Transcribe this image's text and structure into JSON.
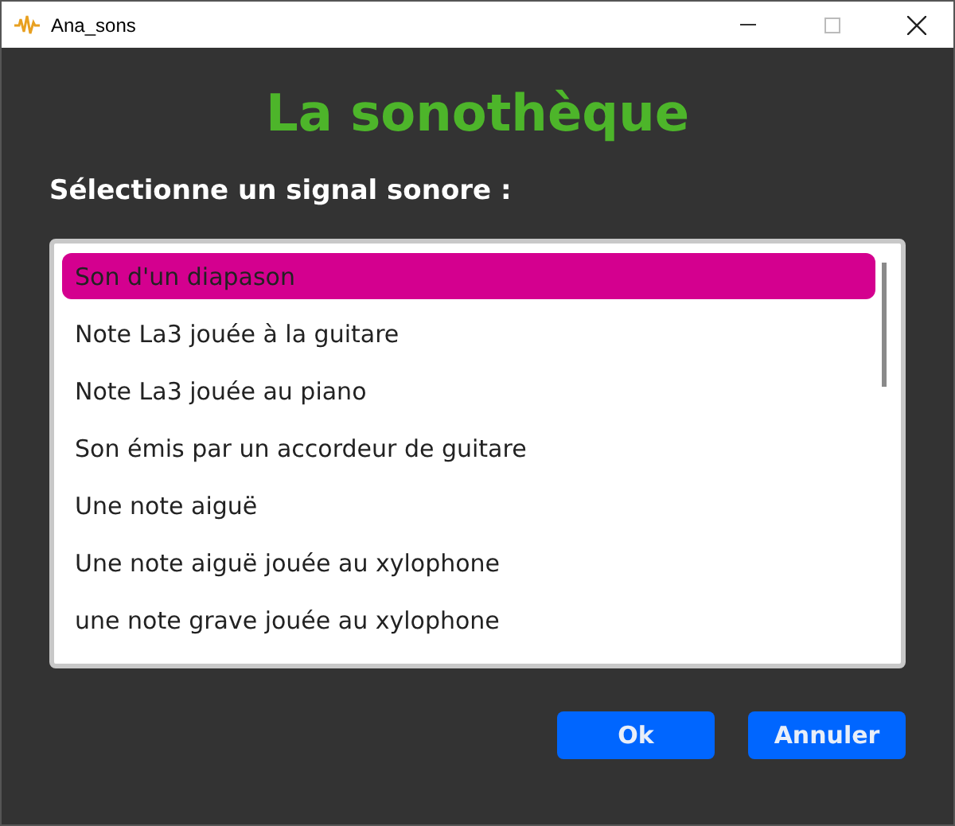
{
  "window": {
    "title": "Ana_sons"
  },
  "heading": "La sonothèque",
  "prompt": "Sélectionne un signal sonore :",
  "list": {
    "items": [
      {
        "label": "Son d'un diapason",
        "selected": true
      },
      {
        "label": "Note La3 jouée à la guitare",
        "selected": false
      },
      {
        "label": "Note La3 jouée au piano",
        "selected": false
      },
      {
        "label": "Son émis par un accordeur de guitare",
        "selected": false
      },
      {
        "label": "Une note aiguë",
        "selected": false
      },
      {
        "label": "Une note aiguë jouée au xylophone",
        "selected": false
      },
      {
        "label": "une note grave jouée au xylophone",
        "selected": false
      }
    ]
  },
  "buttons": [
    "Ok",
    "Annuler"
  ]
}
